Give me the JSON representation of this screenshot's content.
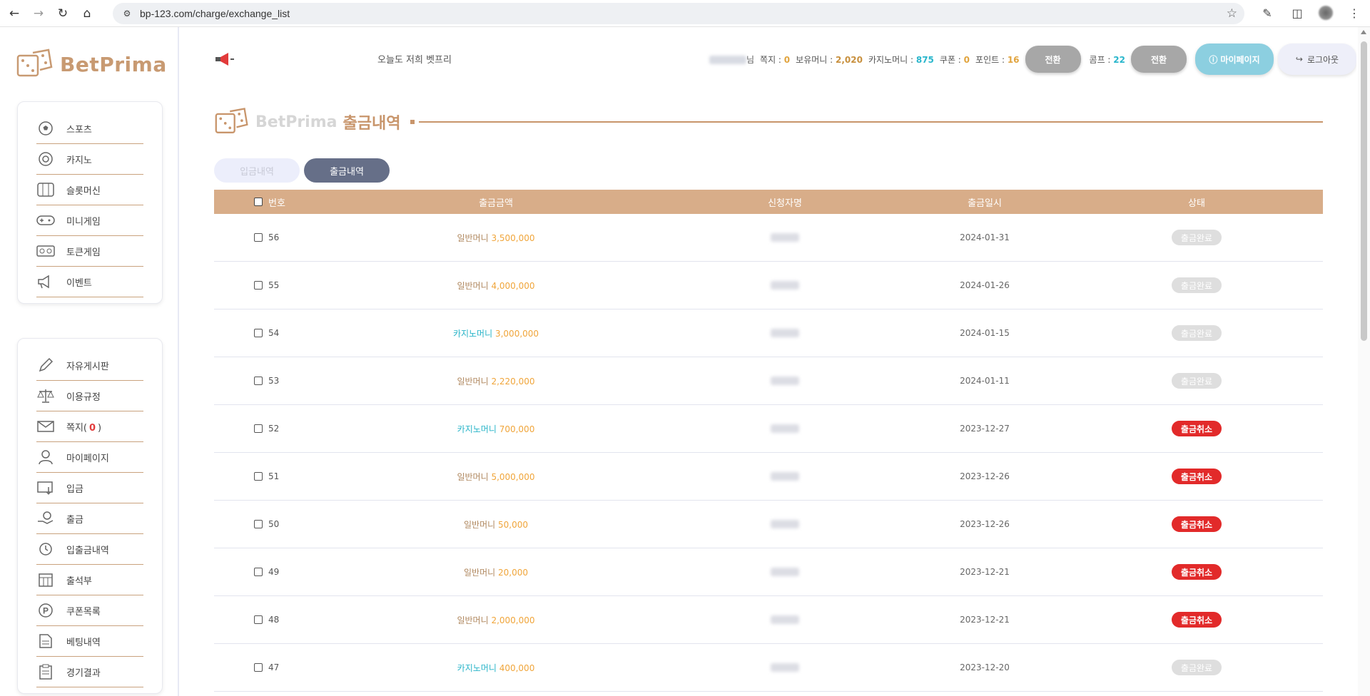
{
  "browser": {
    "url": "bp-123.com/charge/exchange_list"
  },
  "brand": {
    "name": "BetPrima",
    "color": "#c89a72"
  },
  "sidebar": {
    "group1": [
      {
        "label": "스포츠",
        "icon": "soccer-ball-icon"
      },
      {
        "label": "카지노",
        "icon": "casino-chip-icon"
      },
      {
        "label": "슬롯머신",
        "icon": "slot-machine-icon"
      },
      {
        "label": "미니게임",
        "icon": "gamepad-icon"
      },
      {
        "label": "토큰게임",
        "icon": "token-icon"
      },
      {
        "label": "이벤트",
        "icon": "megaphone-icon"
      }
    ],
    "group2": [
      {
        "label": "자유게시판",
        "icon": "pencil-icon"
      },
      {
        "label": "이용규정",
        "icon": "scale-icon"
      },
      {
        "label_prefix": "쪽지(",
        "label_count": "0",
        "label_suffix": ")",
        "icon": "envelope-icon"
      },
      {
        "label": "마이페이지",
        "icon": "user-icon"
      },
      {
        "label": "입금",
        "icon": "deposit-icon"
      },
      {
        "label": "출금",
        "icon": "withdraw-icon"
      },
      {
        "label": "입출금내역",
        "icon": "history-icon"
      },
      {
        "label": "출석부",
        "icon": "calendar-icon"
      },
      {
        "label": "쿠폰목록",
        "icon": "coupon-icon"
      },
      {
        "label": "베팅내역",
        "icon": "document-icon"
      },
      {
        "label": "경기결과",
        "icon": "clipboard-icon"
      }
    ]
  },
  "header": {
    "notice": "오늘도 저희 벳프리",
    "user_suffix": "님",
    "note_label": "쪽지 : ",
    "note_value": "0",
    "holding_label": "보유머니 : ",
    "holding_value": "2,020",
    "casino_label": "카지노머니 : ",
    "casino_value": "875",
    "coupon_label": "쿠폰 : ",
    "coupon_value": "0",
    "point_label": "포인트 : ",
    "point_value": "16",
    "convert_label": "전환",
    "comp_label": "콤프 : ",
    "comp_value": "22",
    "mypage_label": "마이페이지",
    "logout_label": "로그아웃"
  },
  "page": {
    "brand_word": "BetPrima",
    "title": "출금내역",
    "tabs": [
      {
        "label": "입금내역",
        "active": false
      },
      {
        "label": "출금내역",
        "active": true
      }
    ]
  },
  "table": {
    "headers": [
      "번호",
      "출금금액",
      "신청자명",
      "출금일시",
      "상태"
    ],
    "rows": [
      {
        "no": "56",
        "type": "일반머니",
        "amount": "3,500,000",
        "date": "2024-01-31",
        "status": "출금완료"
      },
      {
        "no": "55",
        "type": "일반머니",
        "amount": "4,000,000",
        "date": "2024-01-26",
        "status": "출금완료"
      },
      {
        "no": "54",
        "type": "카지노머니",
        "amount": "3,000,000",
        "date": "2024-01-15",
        "status": "출금완료"
      },
      {
        "no": "53",
        "type": "일반머니",
        "amount": "2,220,000",
        "date": "2024-01-11",
        "status": "출금완료"
      },
      {
        "no": "52",
        "type": "카지노머니",
        "amount": "700,000",
        "date": "2023-12-27",
        "status": "출금취소"
      },
      {
        "no": "51",
        "type": "일반머니",
        "amount": "5,000,000",
        "date": "2023-12-26",
        "status": "출금취소"
      },
      {
        "no": "50",
        "type": "일반머니",
        "amount": "50,000",
        "date": "2023-12-26",
        "status": "출금취소"
      },
      {
        "no": "49",
        "type": "일반머니",
        "amount": "20,000",
        "date": "2023-12-21",
        "status": "출금취소"
      },
      {
        "no": "48",
        "type": "일반머니",
        "amount": "2,000,000",
        "date": "2023-12-21",
        "status": "출금취소"
      },
      {
        "no": "47",
        "type": "카지노머니",
        "amount": "400,000",
        "date": "2023-12-20",
        "status": "출금완료"
      }
    ]
  },
  "colors": {
    "accent": "#c8956b",
    "table_header": "#d8ad89",
    "cancel_badge": "#e22a2a",
    "done_badge": "#dedede",
    "casino_money": "#2bb5c9",
    "amount": "#f0a53a"
  }
}
